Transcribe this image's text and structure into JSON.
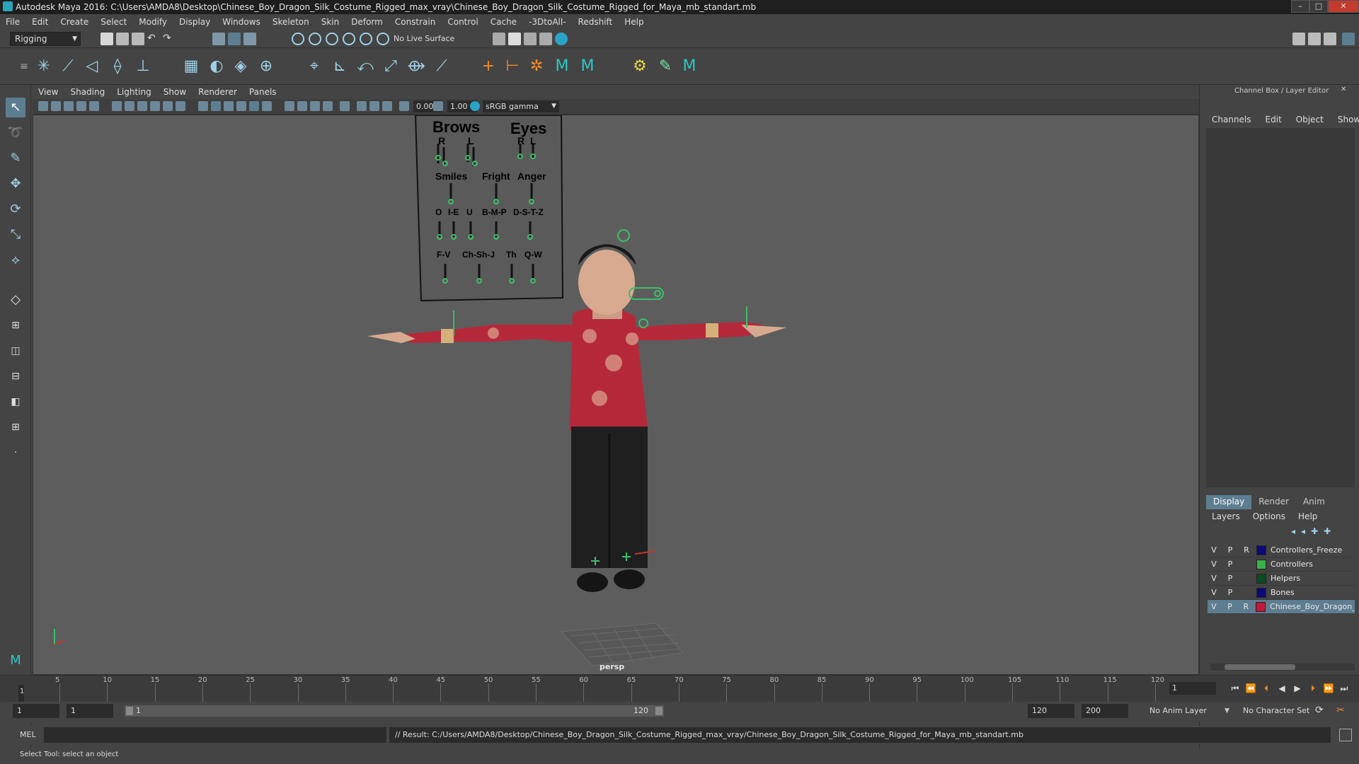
{
  "title": "Autodesk Maya 2016: C:\\Users\\AMDA8\\Desktop\\Chinese_Boy_Dragon_Silk_Costume_Rigged_max_vray\\Chinese_Boy_Dragon_Silk_Costume_Rigged_for_Maya_mb_standart.mb",
  "menus": [
    "File",
    "Edit",
    "Create",
    "Select",
    "Modify",
    "Display",
    "Windows",
    "Skeleton",
    "Skin",
    "Deform",
    "Constrain",
    "Control",
    "Cache",
    "-3DtoAll-",
    "Redshift",
    "Help"
  ],
  "status_line": {
    "menu_set": "Rigging",
    "live_surface": "No Live Surface"
  },
  "panel_menus": [
    "View",
    "Shading",
    "Lighting",
    "Show",
    "Renderer",
    "Panels"
  ],
  "viewport_toolbar": {
    "exposure": "0.00",
    "gamma": "1.00",
    "color_space": "sRGB gamma"
  },
  "viewport": {
    "camera_label": "persp",
    "face_panel": {
      "brows": "Brows",
      "eyes": "Eyes",
      "r1": "R",
      "l1": "L",
      "r2": "R",
      "l2": "L",
      "smiles": "Smiles",
      "fright": "Fright",
      "anger": "Anger",
      "o": "O",
      "i_e": "I-E",
      "u": "U",
      "bmp": "B-M-P",
      "dstz": "D-S-T-Z",
      "fv": "F-V",
      "chshj": "Ch-Sh-J",
      "th": "Th",
      "qw": "Q-W"
    }
  },
  "channel_box": {
    "title": "Channel Box / Layer Editor",
    "menus": [
      "Channels",
      "Edit",
      "Object",
      "Show"
    ]
  },
  "layer_editor": {
    "tabs": [
      "Display",
      "Render",
      "Anim"
    ],
    "menus": [
      "Layers",
      "Options",
      "Help"
    ],
    "layers": [
      {
        "v": "V",
        "p": "P",
        "r": "R",
        "name": "Controllers_Freeze",
        "color": "#0a0a7a"
      },
      {
        "v": "V",
        "p": "P",
        "r": "",
        "name": "Controllers",
        "color": "#3ab04a"
      },
      {
        "v": "V",
        "p": "P",
        "r": "",
        "name": "Helpers",
        "color": "#0a4a22"
      },
      {
        "v": "V",
        "p": "P",
        "r": "",
        "name": "Bones",
        "color": "#0a0a7a"
      },
      {
        "v": "V",
        "p": "P",
        "r": "R",
        "name": "Chinese_Boy_Dragon_",
        "color": "#c0193a"
      }
    ]
  },
  "timeline": {
    "ticks": [
      "5",
      "10",
      "15",
      "20",
      "25",
      "30",
      "35",
      "40",
      "45",
      "50",
      "55",
      "60",
      "65",
      "70",
      "75",
      "80",
      "85",
      "90",
      "95",
      "100",
      "105",
      "110",
      "115",
      "120"
    ],
    "current_frame": "1",
    "start_marker": "1"
  },
  "range_slider": {
    "start": "1",
    "anim_start": "1",
    "range_start": "1",
    "range_end": "120",
    "end": "120",
    "anim_end": "200",
    "anim_layer": "No Anim Layer",
    "char_set": "No Character Set"
  },
  "command_line": {
    "label": "MEL",
    "result": "// Result: C:/Users/AMDA8/Desktop/Chinese_Boy_Dragon_Silk_Costume_Rigged_max_vray/Chinese_Boy_Dragon_Silk_Costume_Rigged_for_Maya_mb_standart.mb"
  },
  "help_line": "Select Tool: select an object",
  "colors": {
    "accent": "#5d7d91",
    "viewport_bg": "#5d5d5d",
    "ui_bg": "#444444"
  }
}
